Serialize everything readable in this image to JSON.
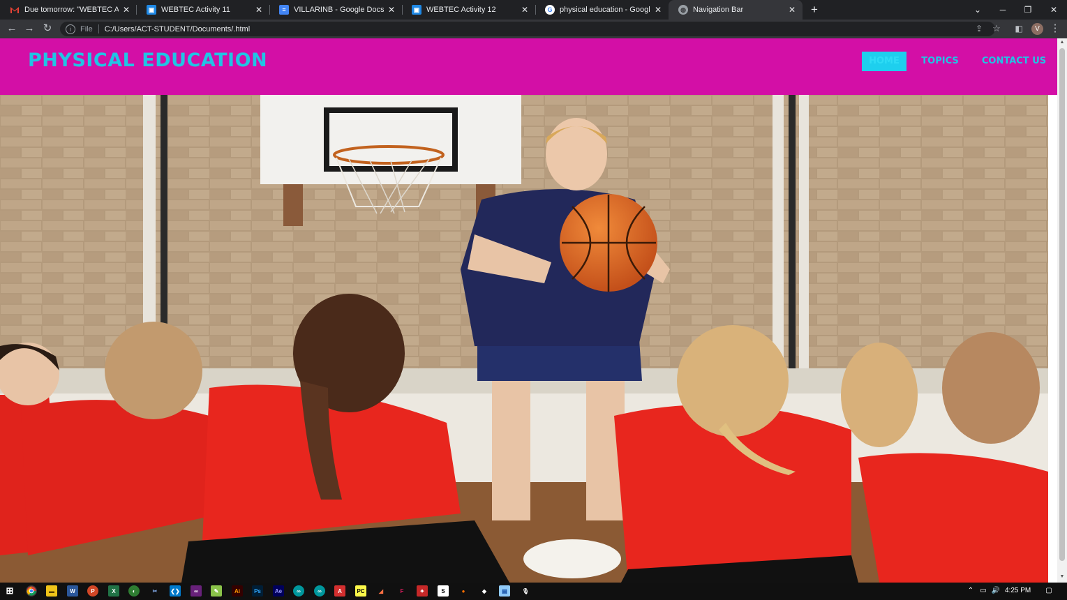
{
  "browser": {
    "tabs": [
      {
        "title": "Due tomorrow: \"WEBTEC Activity",
        "icon": "gmail-icon",
        "active": false
      },
      {
        "title": "WEBTEC Activity 11",
        "icon": "classroom-icon",
        "active": false
      },
      {
        "title": "VILLARINB - Google Docs",
        "icon": "docs-icon",
        "active": false
      },
      {
        "title": "WEBTEC Activity 12",
        "icon": "classroom-icon",
        "active": false
      },
      {
        "title": "physical education - Google Sear",
        "icon": "google-icon",
        "active": false
      },
      {
        "title": "Navigation Bar",
        "icon": "globe-icon",
        "active": true
      }
    ],
    "address": {
      "scheme": "File",
      "url": "C:/Users/ACT-STUDENT/Documents/.html"
    },
    "profile_initial": "V"
  },
  "page": {
    "site_title": "PHYSICAL EDUCATION",
    "nav": [
      {
        "label": "HOME",
        "active": true
      },
      {
        "label": "TOPICS",
        "active": false
      },
      {
        "label": "CONTACT US",
        "active": false
      }
    ],
    "colors": {
      "navbar_bg": "#d30fa6",
      "accent": "#21c4e4"
    }
  },
  "taskbar": {
    "clock": "4:25 PM"
  }
}
